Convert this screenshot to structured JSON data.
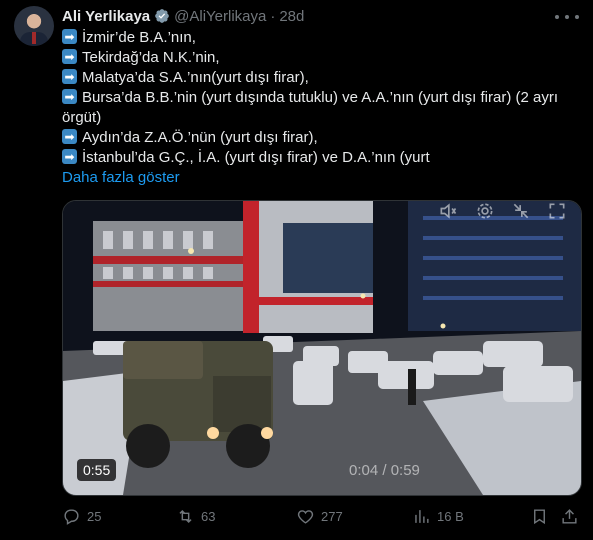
{
  "author": {
    "name": "Ali Yerlikaya",
    "handle": "@AliYerlikaya",
    "separator": "·",
    "time": "28d"
  },
  "tweet": {
    "lines": [
      "İzmir’de B.A.’nın,",
      "Tekirdağ’da N.K.’nin,",
      "Malatya’da S.A.’nın(yurt dışı firar),",
      "Bursa’da B.B.’nin (yurt dışında tutuklu) ve A.A.’nın (yurt dışı firar) (2 ayrı örgüt)",
      "Aydın’da Z.A.Ö.’nün (yurt dışı firar),",
      "İstanbul’da G.Ç., İ.A. (yurt dışı firar) ve D.A.’nın (yurt"
    ],
    "show_more": "Daha fazla göster"
  },
  "video": {
    "duration_badge": "0:55",
    "time_display": "0:04 / 0:59"
  },
  "stats": {
    "replies": "25",
    "reposts": "63",
    "likes": "277",
    "views": "16 B"
  },
  "colors": {
    "accent": "#1d9bf0",
    "muted": "#71767b",
    "text": "#e7e9ea",
    "arrow_emoji": "#3b88c3"
  },
  "icons": [
    "verified-badge-icon",
    "more-icon",
    "arrow-right-icon",
    "mute-icon",
    "settings-icon",
    "fullscreen-icon",
    "reply-icon",
    "repost-icon",
    "like-icon",
    "views-icon",
    "bookmark-icon",
    "share-icon"
  ]
}
